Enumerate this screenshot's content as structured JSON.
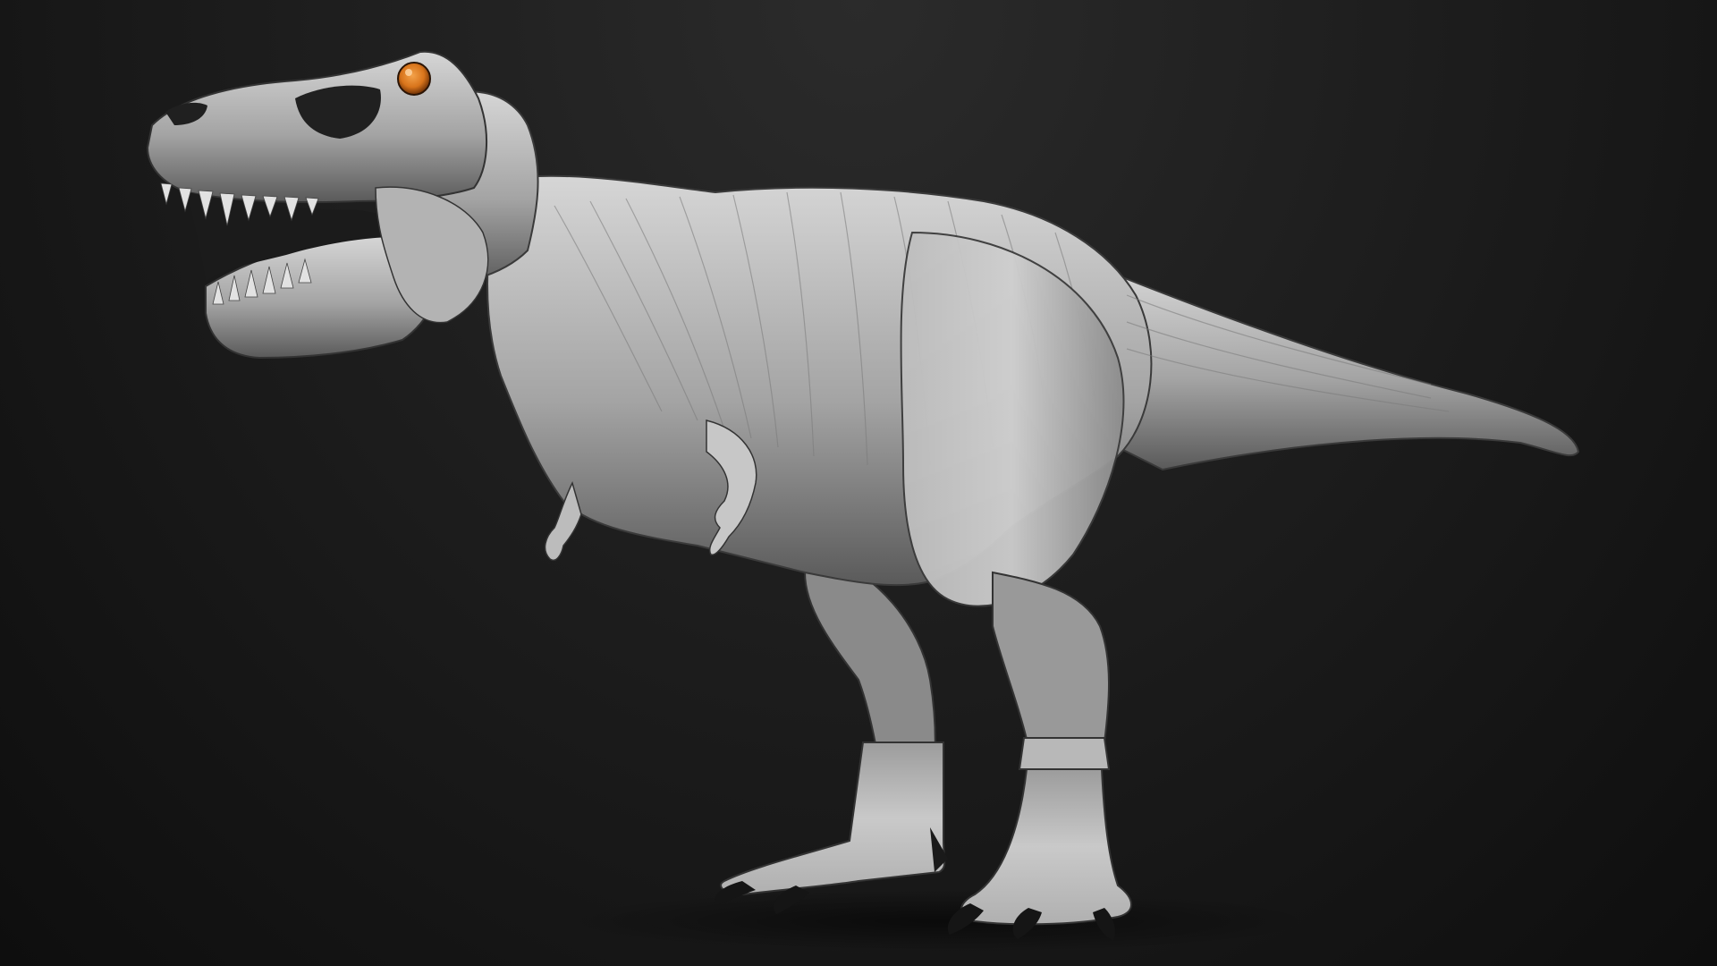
{
  "scene": {
    "subject": "t-rex-sculpt",
    "colors": {
      "background_top": "#2b2b2b",
      "background_bottom": "#0e0e0e",
      "skin_light": "#cfcfcf",
      "skin_mid": "#9a9a9a",
      "skin_dark": "#4a4a4a",
      "eye": "#d8741b",
      "claw": "#151515"
    }
  }
}
